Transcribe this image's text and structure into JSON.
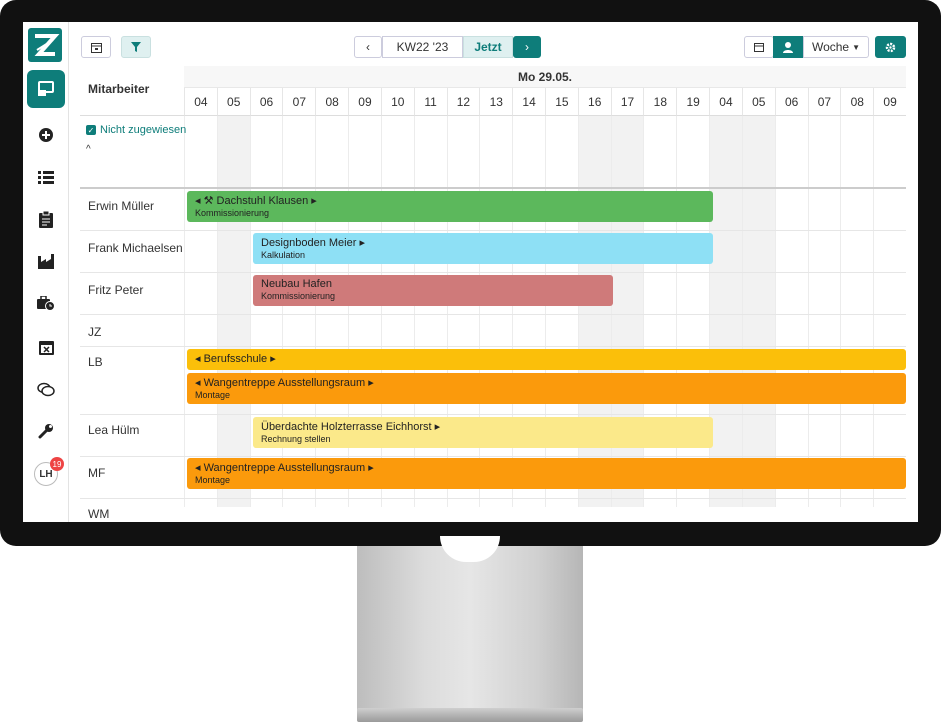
{
  "toolbar": {
    "week_label": "KW22 '23",
    "today_label": "Jetzt",
    "prev_label": "‹",
    "next_label": "›",
    "view_label": "Woche"
  },
  "grid": {
    "name_header": "Mitarbeiter",
    "date_header": "Mo 29.05.",
    "unassigned_label": "Nicht zugewiesen",
    "hours": [
      "04",
      "05",
      "06",
      "07",
      "08",
      "09",
      "10",
      "11",
      "12",
      "13",
      "14",
      "15",
      "16",
      "17",
      "18",
      "19",
      "04",
      "05",
      "06",
      "07",
      "08",
      "09"
    ]
  },
  "employees": [
    {
      "name": "Erwin Müller"
    },
    {
      "name": "Frank Michaelsen"
    },
    {
      "name": "Fritz Peter"
    },
    {
      "name": "JZ"
    },
    {
      "name": "LB"
    },
    {
      "name": "Lea Hülm"
    },
    {
      "name": "MF"
    },
    {
      "name": "WM"
    }
  ],
  "bars": [
    {
      "title": "Dachstuhl Klausen",
      "subtitle": "Kommissionierung",
      "color": "#5cb85c"
    },
    {
      "title": "Designboden Meier",
      "subtitle": "Kalkulation",
      "color": "#8ee0f5"
    },
    {
      "title": "Neubau Hafen",
      "subtitle": "Kommissionierung",
      "color": "#cf7a7a"
    },
    {
      "title": "Berufsschule",
      "subtitle": "",
      "color": "#fbbf0a"
    },
    {
      "title": "Wangentreppe Ausstellungsraum",
      "subtitle": "Montage",
      "color": "#fb9a0c"
    },
    {
      "title": "Überdachte Holzterrasse Eichhorst",
      "subtitle": "Rechnung stellen",
      "color": "#fbe98a"
    },
    {
      "title": "Wangentreppe Ausstellungsraum",
      "subtitle": "Montage",
      "color": "#fb9a0c"
    }
  ],
  "user": {
    "initials": "LH",
    "notifications": "19"
  },
  "colors": {
    "accent": "#0e7d7a"
  }
}
